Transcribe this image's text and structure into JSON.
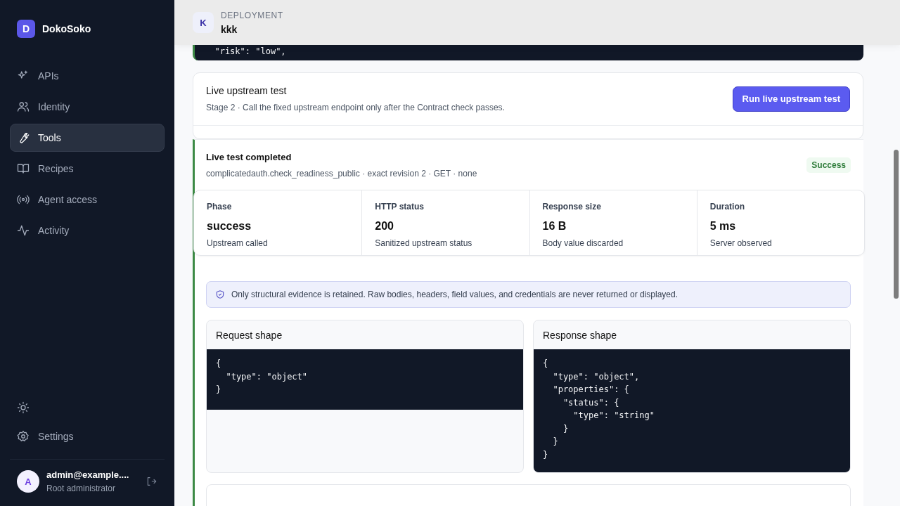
{
  "brand": {
    "initial": "D",
    "name": "DokoSoko"
  },
  "nav": [
    {
      "label": "APIs",
      "kind": "sparkles",
      "selected": false
    },
    {
      "label": "Identity",
      "kind": "users",
      "selected": false
    },
    {
      "label": "Tools",
      "kind": "wrench",
      "selected": true
    },
    {
      "label": "Recipes",
      "kind": "book",
      "selected": false
    },
    {
      "label": "Agent access",
      "kind": "radio",
      "selected": false
    },
    {
      "label": "Activity",
      "kind": "activity",
      "selected": false
    }
  ],
  "settings": {
    "label": "Settings"
  },
  "user": {
    "initial": "A",
    "name": "admin@example....",
    "role": "Root administrator"
  },
  "header": {
    "initial": "K",
    "eyebrow": "DEPLOYMENT",
    "title": "kkk"
  },
  "previous_code": [
    "  \"risk\": \"low\","
  ],
  "live_test": {
    "title": "Live upstream test",
    "description": "Stage 2 · Call the fixed upstream endpoint only after the Contract check passes.",
    "button": "Run live upstream test"
  },
  "result": {
    "title": "Live test completed",
    "subtitle": "complicatedauth.check_readiness_public · exact revision 2 · GET · none",
    "status": "Success",
    "stats": [
      {
        "label": "Phase",
        "value": "success",
        "note": "Upstream called"
      },
      {
        "label": "HTTP status",
        "value": "200",
        "note": "Sanitized upstream status"
      },
      {
        "label": "Response size",
        "value": "16 B",
        "note": "Body value discarded"
      },
      {
        "label": "Duration",
        "value": "5 ms",
        "note": "Server observed"
      }
    ],
    "notice": "Only structural evidence is retained. Raw bodies, headers, field values, and credentials are never returned or displayed.",
    "shapes": [
      {
        "title": "Request shape",
        "code": [
          "{",
          "  \"type\": \"object\"",
          "}"
        ]
      },
      {
        "title": "Response shape",
        "code": [
          "{",
          "  \"type\": \"object\",",
          "  \"properties\": {",
          "    \"status\": {",
          "      \"type\": \"string\"",
          "    }",
          "  }",
          "}"
        ]
      }
    ]
  }
}
